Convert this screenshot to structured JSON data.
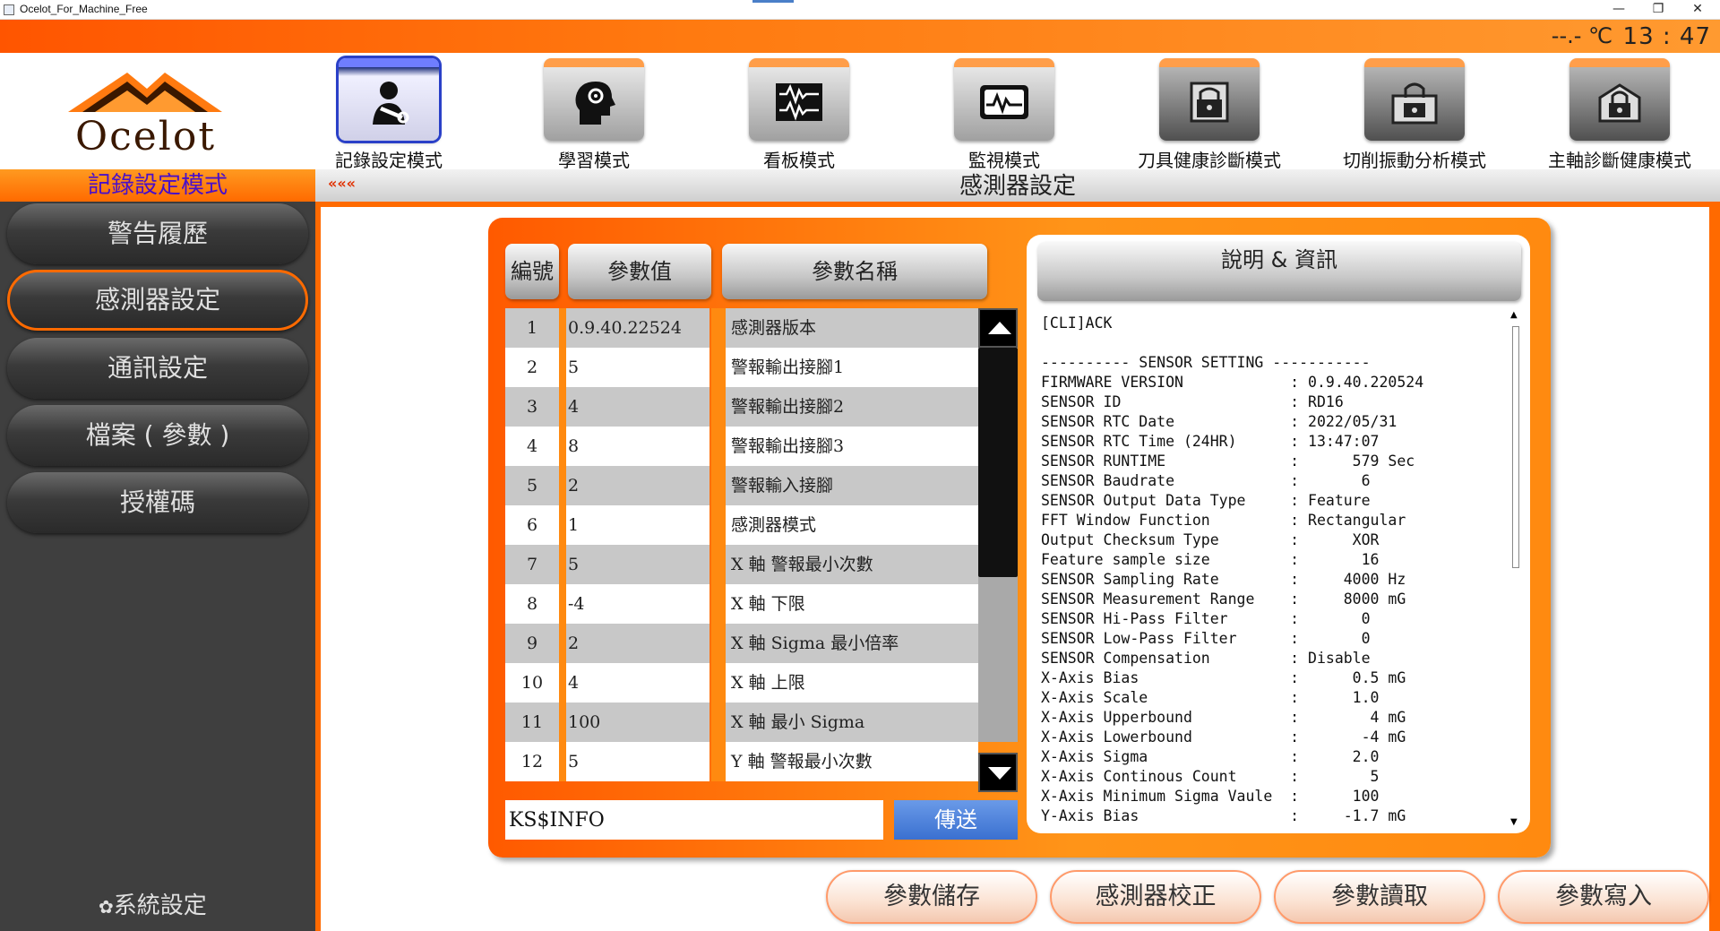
{
  "window": {
    "title": "Ocelot_For_Machine_Free",
    "minimize": "—",
    "restore": "❐",
    "close": "✕"
  },
  "status": {
    "temperature": "--.- ℃",
    "time": "13 : 47"
  },
  "logo": {
    "text": "Ocelot"
  },
  "modes": [
    {
      "label": "記錄設定模式",
      "icon": "person-wrench-icon",
      "active": true
    },
    {
      "label": "學習模式",
      "icon": "head-gear-icon",
      "active": false
    },
    {
      "label": "看板模式",
      "icon": "waveform-board-icon",
      "active": false
    },
    {
      "label": "監視模式",
      "icon": "monitor-wave-icon",
      "active": false
    },
    {
      "label": "刀具健康診斷模式",
      "icon": "locked-tool-icon",
      "active": false
    },
    {
      "label": "切削振動分析模式",
      "icon": "locked-vibration-icon",
      "active": false
    },
    {
      "label": "主軸診斷健康模式",
      "icon": "locked-spindle-icon",
      "active": false
    }
  ],
  "sidebar": {
    "header": "記錄設定模式",
    "items": [
      {
        "label": "警告履歷",
        "active": false
      },
      {
        "label": "感測器設定",
        "active": true
      },
      {
        "label": "通訊設定",
        "active": false
      },
      {
        "label": "檔案 ( 參數 )",
        "active": false
      },
      {
        "label": "授權碼",
        "active": false
      }
    ],
    "settings": "系統設定"
  },
  "main": {
    "back": "«««",
    "title": "感測器設定"
  },
  "table": {
    "headers": {
      "id": "編號",
      "value": "參數值",
      "name": "參數名稱"
    },
    "rows": [
      {
        "id": "1",
        "value": "0.9.40.22524",
        "name": "感測器版本"
      },
      {
        "id": "2",
        "value": "5",
        "name": "警報輸出接腳1"
      },
      {
        "id": "3",
        "value": "4",
        "name": "警報輸出接腳2"
      },
      {
        "id": "4",
        "value": "8",
        "name": "警報輸出接腳3"
      },
      {
        "id": "5",
        "value": "2",
        "name": "警報輸入接腳"
      },
      {
        "id": "6",
        "value": "1",
        "name": "感測器模式"
      },
      {
        "id": "7",
        "value": "5",
        "name": "X 軸 警報最小次數"
      },
      {
        "id": "8",
        "value": "-4",
        "name": "X 軸 下限"
      },
      {
        "id": "9",
        "value": "2",
        "name": "X 軸 Sigma 最小倍率"
      },
      {
        "id": "10",
        "value": "4",
        "name": "X 軸 上限"
      },
      {
        "id": "11",
        "value": "100",
        "name": "X 軸 最小 Sigma"
      },
      {
        "id": "12",
        "value": "5",
        "name": "Y 軸 警報最小次數"
      }
    ]
  },
  "command": {
    "value": "KS$INFO",
    "send": "傳送"
  },
  "info": {
    "header": "說明 & 資訊",
    "text": "[CLI]ACK\n\n---------- SENSOR SETTING -----------\nFIRMWARE VERSION            : 0.9.40.220524\nSENSOR ID                   : RD16\nSENSOR RTC Date             : 2022/05/31\nSENSOR RTC Time (24HR)      : 13:47:07\nSENSOR RUNTIME              :      579 Sec\nSENSOR Baudrate             :       6\nSENSOR Output Data Type     : Feature\nFFT Window Function         : Rectangular\nOutput Checksum Type        :      XOR\nFeature sample size         :       16\nSENSOR Sampling Rate        :     4000 Hz\nSENSOR Measurement Range    :     8000 mG\nSENSOR Hi-Pass Filter       :       0\nSENSOR Low-Pass Filter      :       0\nSENSOR Compensation         : Disable\nX-Axis Bias                 :      0.5 mG\nX-Axis Scale                :      1.0\nX-Axis Upperbound           :        4 mG\nX-Axis Lowerbound           :       -4 mG\nX-Axis Sigma                :      2.0\nX-Axis Continous Count      :        5\nX-Axis Minimum Sigma Vaule  :      100\nY-Axis Bias                 :     -1.7 mG"
  },
  "actions": {
    "save": "參數儲存",
    "calibrate": "感測器校正",
    "read": "參數讀取",
    "write": "參數寫入"
  }
}
